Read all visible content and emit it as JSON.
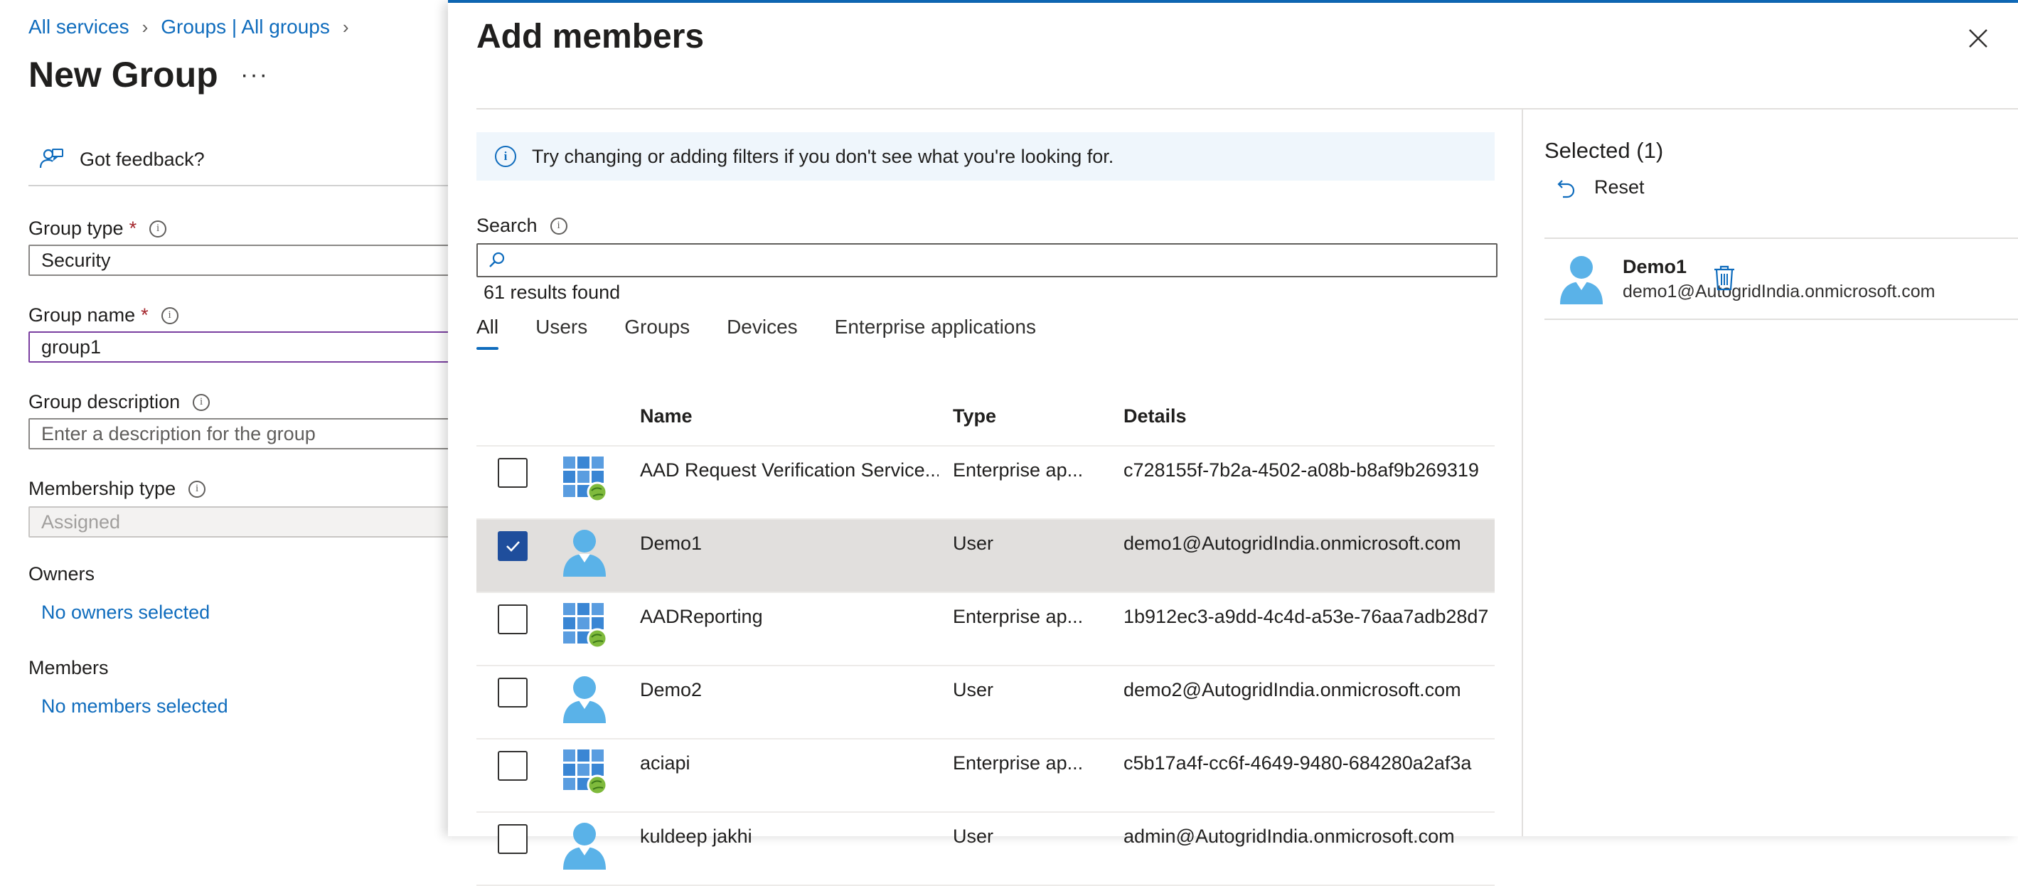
{
  "breadcrumb": {
    "items": [
      "All services",
      "Groups | All groups"
    ]
  },
  "page": {
    "title": "New Group",
    "more": "···"
  },
  "feedback": {
    "label": "Got feedback?"
  },
  "form": {
    "group_type": {
      "label": "Group type",
      "required": "*",
      "value": "Security"
    },
    "group_name": {
      "label": "Group name",
      "required": "*",
      "value": "group1"
    },
    "group_description": {
      "label": "Group description",
      "placeholder": "Enter a description for the group"
    },
    "membership_type": {
      "label": "Membership type",
      "value": "Assigned"
    },
    "owners": {
      "label": "Owners",
      "link": "No owners selected"
    },
    "members": {
      "label": "Members",
      "link": "No members selected"
    }
  },
  "panel": {
    "title": "Add members",
    "info": "Try changing or adding filters if you don't see what you're looking for.",
    "search_label": "Search",
    "search_value": "",
    "results": "61 results found",
    "tabs": [
      "All",
      "Users",
      "Groups",
      "Devices",
      "Enterprise applications"
    ],
    "active_tab": "All",
    "columns": {
      "name": "Name",
      "type": "Type",
      "details": "Details"
    },
    "rows": [
      {
        "name": "AAD Request Verification Service...",
        "type": "Enterprise ap...",
        "details": "c728155f-7b2a-4502-a08b-b8af9b269319",
        "icon": "app-icon",
        "checked": false
      },
      {
        "name": "Demo1",
        "type": "User",
        "details": "demo1@AutogridIndia.onmicrosoft.com",
        "icon": "user-icon",
        "checked": true
      },
      {
        "name": "AADReporting",
        "type": "Enterprise ap...",
        "details": "1b912ec3-a9dd-4c4d-a53e-76aa7adb28d7",
        "icon": "app-icon",
        "checked": false
      },
      {
        "name": "Demo2",
        "type": "User",
        "details": "demo2@AutogridIndia.onmicrosoft.com",
        "icon": "user-icon",
        "checked": false
      },
      {
        "name": "aciapi",
        "type": "Enterprise ap...",
        "details": "c5b17a4f-cc6f-4649-9480-684280a2af3a",
        "icon": "app-icon",
        "checked": false
      },
      {
        "name": "kuldeep jakhi",
        "type": "User",
        "details": "admin@AutogridIndia.onmicrosoft.com",
        "icon": "user-icon",
        "checked": false
      }
    ]
  },
  "selected": {
    "title": "Selected (1)",
    "reset": "Reset",
    "items": [
      {
        "name": "Demo1",
        "email": "demo1@AutogridIndia.onmicrosoft.com"
      }
    ]
  },
  "colors": {
    "accent": "#0f6cbd",
    "checkbox_checked": "#1f4e9c",
    "selected_row": "#e1dfdd",
    "required": "#a4262c"
  }
}
